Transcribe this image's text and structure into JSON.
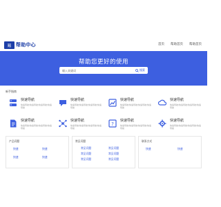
{
  "header": {
    "logo_mark": "易",
    "logo_text": "帮助中心",
    "nav": [
      "首页",
      "帮助首页",
      "帮助首页"
    ]
  },
  "hero": {
    "title": "帮助您更好的使用",
    "search_placeholder": "输入关键词",
    "search_button": "搜索"
  },
  "guide": {
    "section_title": "新手指南",
    "cards": [
      {
        "title": "快速导航",
        "desc": "快速导航/快速导航/快速导航/快速导航",
        "icon": "server-icon"
      },
      {
        "title": "快速导航",
        "desc": "快速导航/快速导航/快速导航/快速导航",
        "icon": "chat-icon"
      },
      {
        "title": "快速导航",
        "desc": "快速导航/快速导航/快速导航/快速导航",
        "icon": "chart-icon"
      },
      {
        "title": "快速导航",
        "desc": "快速导航/快速导航/快速导航/快速导航",
        "icon": "cloud-icon"
      },
      {
        "title": "快速导航",
        "desc": "快速导航/快速导航/快速导航/快速导航",
        "icon": "document-icon"
      },
      {
        "title": "快速导航",
        "desc": "快速导航/快速导航/快速导航/快速导航",
        "icon": "network-icon"
      },
      {
        "title": "快速导航",
        "desc": "快速导航/快速导航/快速导航/快速导航",
        "icon": "question-icon"
      },
      {
        "title": "快速导航",
        "desc": "快速导航/快速导航/快速导航/快速导航",
        "icon": "settings-icon"
      }
    ]
  },
  "boxes": [
    {
      "title": "产品问题",
      "links": [
        "快速",
        "快速",
        "快速",
        "快速"
      ]
    },
    {
      "title": "常见问题",
      "links": [
        "常见问题",
        "常见问题",
        "常见问题",
        "常见问题",
        "常见问题",
        "常见问题"
      ]
    },
    {
      "title": "联系方式",
      "links": [
        "快速",
        "快速"
      ]
    }
  ],
  "colors": {
    "accent": "#3d5fe0",
    "logo": "#1d3fa8"
  }
}
